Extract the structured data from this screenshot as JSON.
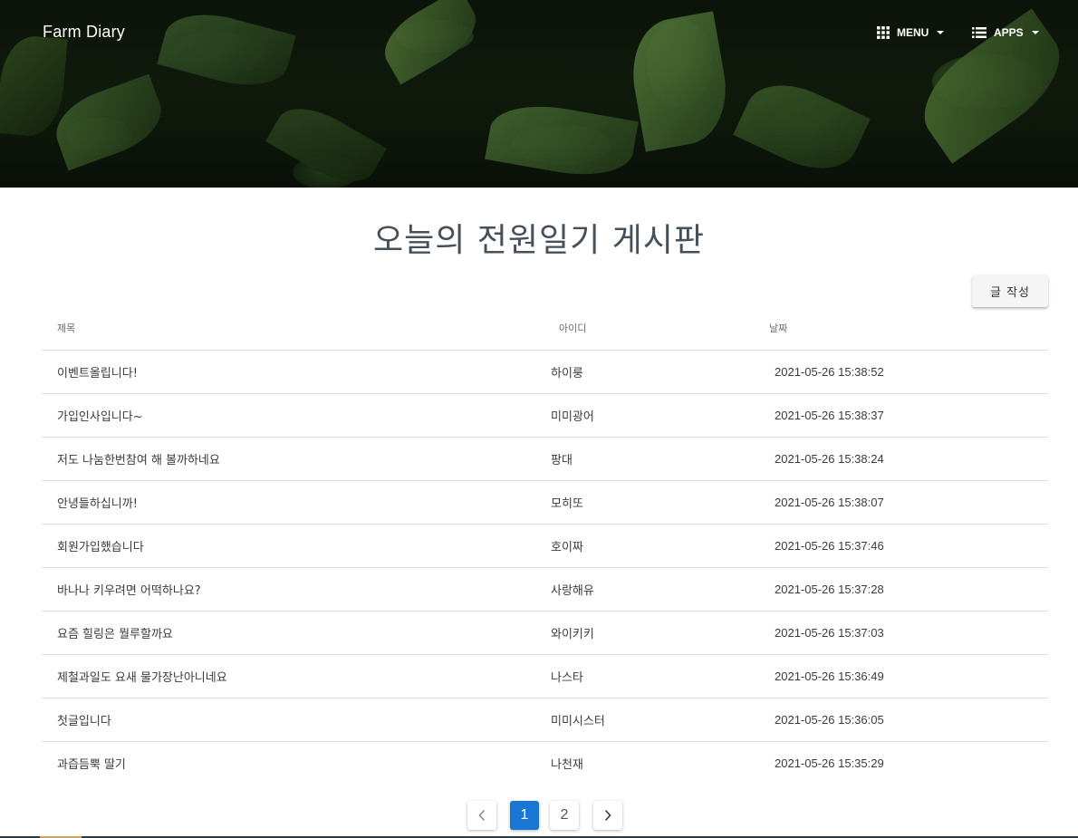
{
  "header": {
    "brand": "Farm Diary",
    "menu_label": "MENU",
    "apps_label": "APPS"
  },
  "main": {
    "title": "오늘의 전원일기 게시판",
    "write_button": "글 작성"
  },
  "table": {
    "columns": [
      "제목",
      "아이디",
      "날짜"
    ],
    "rows": [
      {
        "title": "이벤트올립니다!",
        "id": "하이룽",
        "date": "2021-05-26 15:38:52"
      },
      {
        "title": "가입인사입니다~",
        "id": "미미광어",
        "date": "2021-05-26 15:38:37"
      },
      {
        "title": "저도 나눔한번참여 해 볼까하네요",
        "id": "팡대",
        "date": "2021-05-26 15:38:24"
      },
      {
        "title": "안녕들하십니까!",
        "id": "모히또",
        "date": "2021-05-26 15:38:07"
      },
      {
        "title": "회원가입했습니다",
        "id": "호이짜",
        "date": "2021-05-26 15:37:46"
      },
      {
        "title": "바나나 키우려면 어떡하나요?",
        "id": "사랑해유",
        "date": "2021-05-26 15:37:28"
      },
      {
        "title": "요즘 힐링은 뭘루할까요",
        "id": "와이키키",
        "date": "2021-05-26 15:37:03"
      },
      {
        "title": "제철과일도 요새 물가장난아니네요",
        "id": "나스타",
        "date": "2021-05-26 15:36:49"
      },
      {
        "title": "첫글입니다",
        "id": "미미시스터",
        "date": "2021-05-26 15:36:05"
      },
      {
        "title": "과즙듬뿍 딸기",
        "id": "나천재",
        "date": "2021-05-26 15:35:29"
      }
    ]
  },
  "pagination": {
    "pages": [
      "1",
      "2"
    ],
    "current": "1"
  },
  "icons": {
    "menu": "grid-icon",
    "apps": "list-icon",
    "prev": "chevron-left-icon",
    "next": "chevron-right-icon"
  },
  "colors": {
    "accent": "#1976d2",
    "title": "#46505a"
  }
}
